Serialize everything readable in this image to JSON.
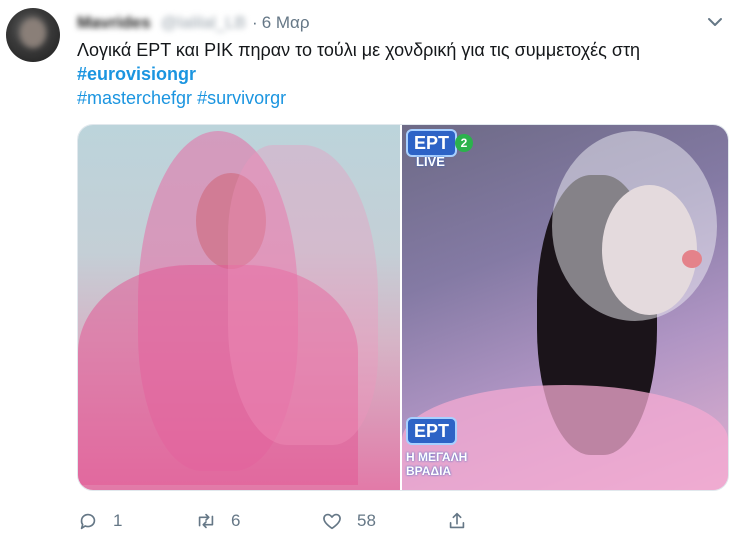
{
  "tweet": {
    "author_name": "Mavrides",
    "author_handle": "@lalilal_LB",
    "separator": "·",
    "date": "6 Μαρ",
    "text_line1": "Λογικά ΕΡΤ και ΡΙΚ πηραν το τούλι με χονδρική για τις συμμετοχές στη",
    "hashtag_bold": "#eurovisiongr",
    "hashtag_1": "#masterchefgr",
    "hashtag_2": "#survivorgr"
  },
  "media": {
    "right_image": {
      "channel_logo": "ΕΡΤ",
      "channel_number": "2",
      "live_label": "LIVE",
      "bottom_logo": "ΕΡΤ",
      "show_line1": "Η ΜΕΓΑΛΗ",
      "show_line2": "ΒΡΑΔΙΑ"
    }
  },
  "actions": {
    "reply_count": "1",
    "retweet_count": "6",
    "like_count": "58"
  },
  "icons": {
    "caret": "chevron-down-icon",
    "reply": "reply-icon",
    "retweet": "retweet-icon",
    "like": "heart-icon",
    "share": "share-icon"
  },
  "colors": {
    "link": "#1b95e0",
    "muted": "#657786",
    "ert_blue": "#2d63c6"
  }
}
